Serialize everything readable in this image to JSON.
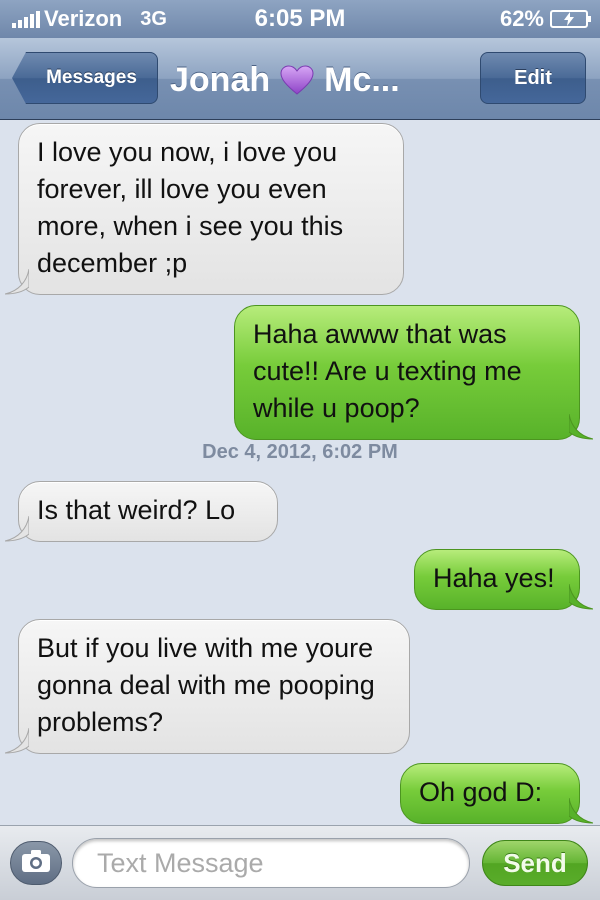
{
  "status_bar": {
    "carrier": "Verizon",
    "network": "3G",
    "time": "6:05 PM",
    "battery": "62%"
  },
  "nav": {
    "back_label": "Messages",
    "title_first": "Jonah",
    "title_last": "Mc...",
    "edit_label": "Edit"
  },
  "messages": [
    {
      "direction": "in",
      "text": "I love you now, i love you forever, ill love you even more, when i see you this december ;p"
    },
    {
      "direction": "out",
      "text": "Haha awww that was cute!! Are u texting me while u poop?"
    },
    {
      "direction": "in",
      "text": "Is that weird? Lo"
    },
    {
      "direction": "out",
      "text": "Haha yes!"
    },
    {
      "direction": "in",
      "text": "But if you live with me youre gonna deal with me pooping problems?"
    },
    {
      "direction": "out",
      "text": "Oh god D:"
    }
  ],
  "timestamp": "Dec 4, 2012, 6:02 PM",
  "input": {
    "placeholder": "Text Message",
    "send_label": "Send"
  },
  "colors": {
    "incoming_bubble": "#e8e8e8",
    "outgoing_bubble": "#6cc436",
    "nav_bar": "#7890b2",
    "background": "#dbe2ed",
    "heart": "#a65fd6"
  },
  "icons": {
    "heart": "purple-heart-icon",
    "camera": "camera-icon",
    "battery": "battery-icon",
    "signal": "signal-icon"
  }
}
